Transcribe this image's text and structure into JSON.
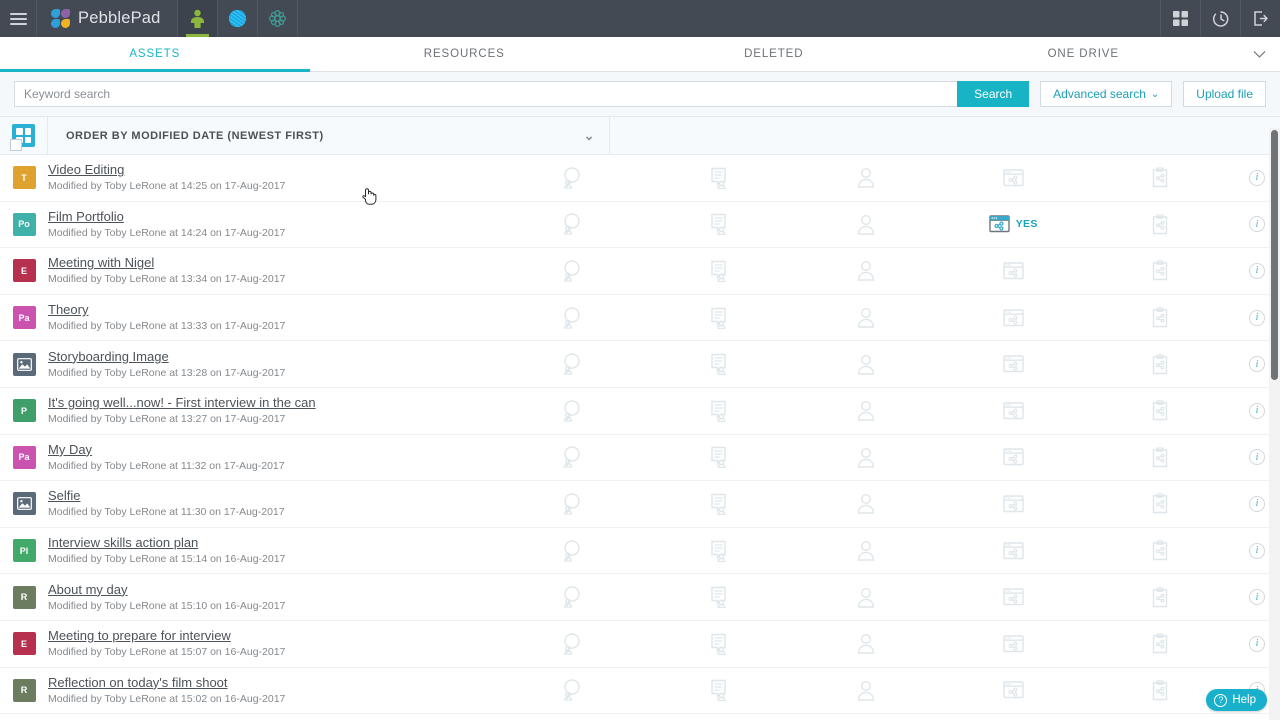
{
  "topbar": {
    "menu_icon": "hamburger-icon",
    "brand": "PebblePad",
    "nav_icons": [
      {
        "name": "person-green-icon",
        "active": true
      },
      {
        "name": "blue-circle-icon",
        "active": false
      },
      {
        "name": "teal-flower-icon",
        "active": false
      }
    ],
    "right_icons": [
      {
        "name": "apps-grid-icon"
      },
      {
        "name": "history-clock-icon"
      },
      {
        "name": "logout-icon"
      }
    ]
  },
  "tabs": {
    "items": [
      {
        "label": "ASSETS",
        "active": true
      },
      {
        "label": "RESOURCES",
        "active": false
      },
      {
        "label": "DELETED",
        "active": false
      },
      {
        "label": "ONE DRIVE",
        "active": false
      }
    ],
    "caret": "⌄"
  },
  "search": {
    "value": "",
    "placeholder": "Keyword search",
    "search_label": "Search",
    "advanced_label": "Advanced search",
    "advanced_caret": "⌄",
    "upload_label": "Upload file"
  },
  "sort": {
    "label": "ORDER BY MODIFIED DATE (NEWEST FIRST)",
    "caret": "⌄",
    "view_toggle_icon": "grid-view-icon"
  },
  "columns": [
    "comments",
    "feedback",
    "shared-with",
    "published",
    "submitted",
    "info"
  ],
  "rows": [
    {
      "badge": "T",
      "badge_color": "#e0a22f",
      "type": "text",
      "title": "Video Editing",
      "meta": "Modified by Toby LeRone at 14:25 on 17-Aug-2017",
      "published": ""
    },
    {
      "badge": "Po",
      "badge_color": "#40b1a8",
      "type": "text",
      "title": "Film Portfolio",
      "meta": "Modified by Toby LeRone at 14:24 on 17-Aug-2017",
      "published": "YES"
    },
    {
      "badge": "E",
      "badge_color": "#b7304e",
      "type": "text",
      "title": "Meeting with Nigel",
      "meta": "Modified by Toby LeRone at 13:34 on 17-Aug-2017",
      "published": ""
    },
    {
      "badge": "Pa",
      "badge_color": "#cb53b0",
      "type": "text",
      "title": "Theory",
      "meta": "Modified by Toby LeRone at 13:33 on 17-Aug-2017",
      "published": ""
    },
    {
      "badge": "",
      "badge_color": "#5b6a78",
      "type": "image",
      "title": "Storyboarding Image",
      "meta": "Modified by Toby LeRone at 13:28 on 17-Aug-2017",
      "published": ""
    },
    {
      "badge": "P",
      "badge_color": "#3f9e69",
      "type": "text",
      "title": "It's going well...now! - First interview in the can",
      "meta": "Modified by Toby LeRone at 13:27 on 17-Aug-2017",
      "published": ""
    },
    {
      "badge": "Pa",
      "badge_color": "#cb53b0",
      "type": "text",
      "title": "My Day",
      "meta": "Modified by Toby LeRone at 11:32 on 17-Aug-2017",
      "published": ""
    },
    {
      "badge": "",
      "badge_color": "#5b6a78",
      "type": "image",
      "title": "Selfie",
      "meta": "Modified by Toby LeRone at 11:30 on 17-Aug-2017",
      "published": ""
    },
    {
      "badge": "Pl",
      "badge_color": "#41a969",
      "type": "text",
      "title": "Interview skills action plan",
      "meta": "Modified by Toby LeRone at 15:14 on 16-Aug-2017",
      "published": ""
    },
    {
      "badge": "R",
      "badge_color": "#6c7d5f",
      "type": "text",
      "title": "About my day",
      "meta": "Modified by Toby LeRone at 15:10 on 16-Aug-2017",
      "published": ""
    },
    {
      "badge": "E",
      "badge_color": "#b7304e",
      "type": "text",
      "title": "Meeting to prepare for interview",
      "meta": "Modified by Toby LeRone at 15:07 on 16-Aug-2017",
      "published": ""
    },
    {
      "badge": "R",
      "badge_color": "#6c7d5f",
      "type": "text",
      "title": "Reflection on today's film shoot",
      "meta": "Modified by Toby LeRone at 15:02 on 16-Aug-2017",
      "published": ""
    }
  ],
  "help": {
    "label": "Help",
    "icon": "question-mark-icon",
    "symbol": "?"
  },
  "colors": {
    "accent": "#18b3c4",
    "topbar": "#434a54",
    "active_tab": "#17b5c6",
    "green_underline": "#8cb63c"
  }
}
